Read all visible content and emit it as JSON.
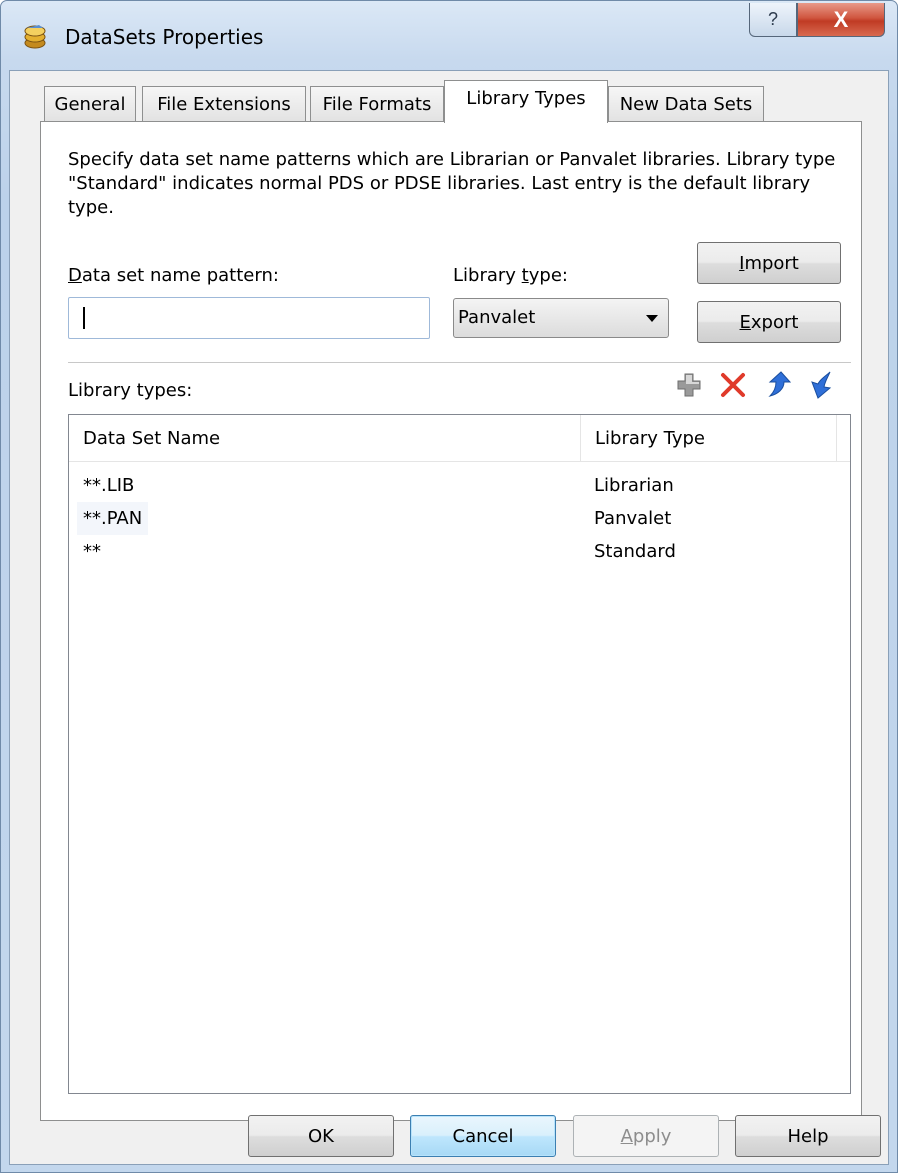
{
  "window": {
    "title": "DataSets Properties",
    "help_glyph": "?",
    "close_glyph": "X",
    "app_icon": "datasets-app-icon"
  },
  "tabs": [
    {
      "label": "General",
      "active": false
    },
    {
      "label": "File Extensions",
      "active": false
    },
    {
      "label": "File Formats",
      "active": false
    },
    {
      "label": "Library Types",
      "active": true
    },
    {
      "label": "New Data Sets",
      "active": false
    }
  ],
  "page": {
    "description": "Specify data set name patterns which are Librarian or Panvalet libraries.  Library type \"Standard\" indicates normal PDS or PDSE libraries.  Last entry is the default library type.",
    "pattern_label_ul": "D",
    "pattern_label_rest": "ata set name pattern:",
    "pattern_value": "",
    "type_label_pre": "Library ",
    "type_label_ul": "t",
    "type_label_rest": "ype:",
    "type_selected": "Panvalet",
    "import_ul": "I",
    "import_rest": "mport",
    "export_ul": "E",
    "export_rest": "xport",
    "list_label": "Library types:",
    "toolbar_icons": [
      "add-icon",
      "delete-icon",
      "move-up-icon",
      "move-down-icon"
    ]
  },
  "table": {
    "columns": [
      "Data Set Name",
      "Library Type"
    ],
    "rows": [
      {
        "name": "**.LIB",
        "type": "Librarian"
      },
      {
        "name": "**.PAN",
        "type": "Panvalet"
      },
      {
        "name": "**",
        "type": "Standard"
      }
    ]
  },
  "footer": {
    "ok": "OK",
    "cancel": "Cancel",
    "apply_ul": "A",
    "apply_rest": "pply",
    "help": "Help"
  },
  "colors": {
    "close_button": "#c03b24",
    "delete_icon": "#e03a2a",
    "arrow_icons": "#2f6fd8",
    "add_icon": "#8a8a8a"
  }
}
